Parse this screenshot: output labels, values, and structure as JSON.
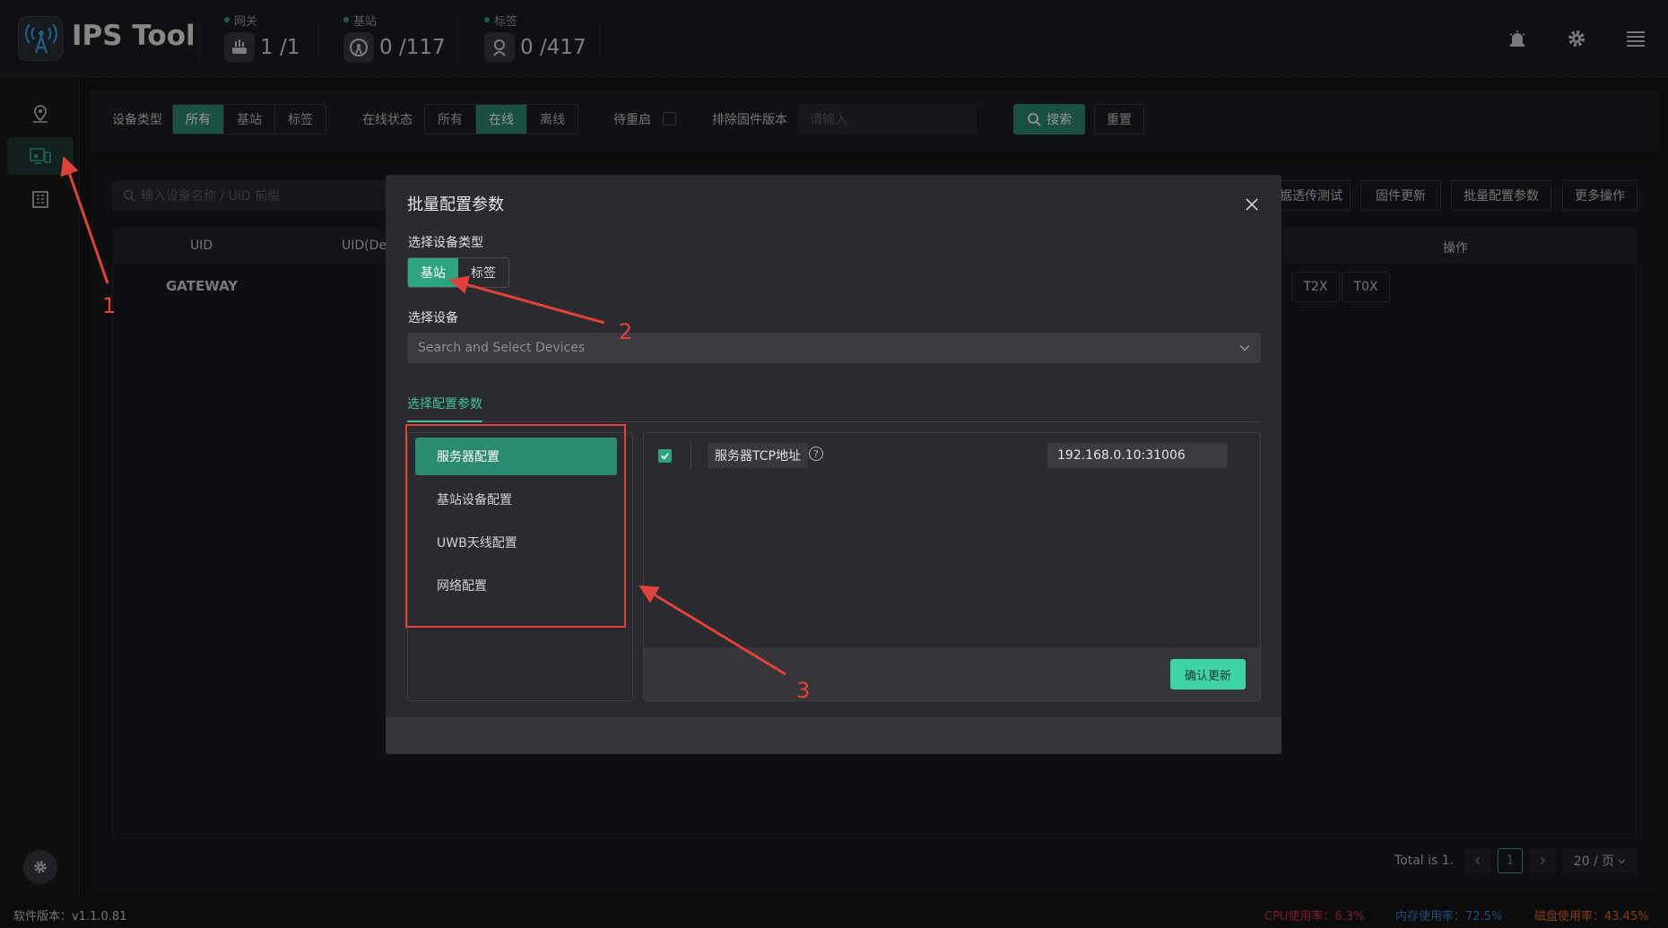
{
  "app": {
    "title": "IPS Tool"
  },
  "header": {
    "stats": [
      {
        "label": "网关",
        "value": "1 /1",
        "icon": "gateway-icon"
      },
      {
        "label": "基站",
        "value": "0 /117",
        "icon": "base-station-icon"
      },
      {
        "label": "标签",
        "value": "0 /417",
        "icon": "tag-icon"
      }
    ],
    "icons": [
      "alarm-icon",
      "gear-icon",
      "menu-icon"
    ]
  },
  "sidebar": {
    "items": [
      {
        "name": "map-pin",
        "icon": "map-pin-icon",
        "active": false
      },
      {
        "name": "devices",
        "icon": "devices-icon",
        "active": true
      },
      {
        "name": "building",
        "icon": "building-icon",
        "active": false
      }
    ]
  },
  "filters": {
    "device_type_label": "设备类型",
    "device_type_options": [
      "所有",
      "基站",
      "标签"
    ],
    "device_type_selected": "所有",
    "online_status_label": "在线状态",
    "online_status_options": [
      "所有",
      "在线",
      "离线"
    ],
    "online_status_selected": "在线",
    "pending_restart_label": "待重启",
    "exclude_firmware_label": "排除固件版本",
    "exclude_firmware_placeholder": "请输入",
    "search_button": "搜索",
    "reset_button": "重置"
  },
  "main": {
    "search_placeholder": "输入设备名称 / UID 前缀",
    "action_buttons": [
      "据透传测试",
      "固件更新",
      "批量配置参数",
      "更多操作"
    ],
    "columns": [
      "UID",
      "UID(De",
      "操作"
    ],
    "rows": [
      {
        "uid": "GATEWAY",
        "ops": [
          "T2X",
          "T0X"
        ]
      }
    ],
    "pagination": {
      "total": "Total is 1.",
      "current_page": "1",
      "page_size": "20 / 页"
    }
  },
  "modal": {
    "title": "批量配置参数",
    "select_type_label": "选择设备类型",
    "type_options": [
      "基站",
      "标签"
    ],
    "type_selected": "基站",
    "select_device_label": "选择设备",
    "device_placeholder": "Search and Select Devices",
    "config_tab": "选择配置参数",
    "menu": [
      "服务器配置",
      "基站设备配置",
      "UWB天线配置",
      "网络配置"
    ],
    "menu_selected": "服务器配置",
    "field_label": "服务器TCP地址",
    "field_help": "?",
    "field_value": "192.168.0.10:31006",
    "confirm_button": "确认更新"
  },
  "footer": {
    "version": "软件版本：v1.1.0.81",
    "cpu": "CPU使用率：6.3%",
    "memory": "内存使用率：72.5%",
    "disk": "磁盘使用率：43.45%"
  },
  "annotations": [
    "1",
    "2",
    "3"
  ],
  "colors": {
    "accent": "#2b8b70",
    "accent_light": "#3fd3aa",
    "annotation": "#e0423a",
    "cpu": "#d6334a",
    "memory": "#3b82d6",
    "disk": "#e06a2a"
  }
}
